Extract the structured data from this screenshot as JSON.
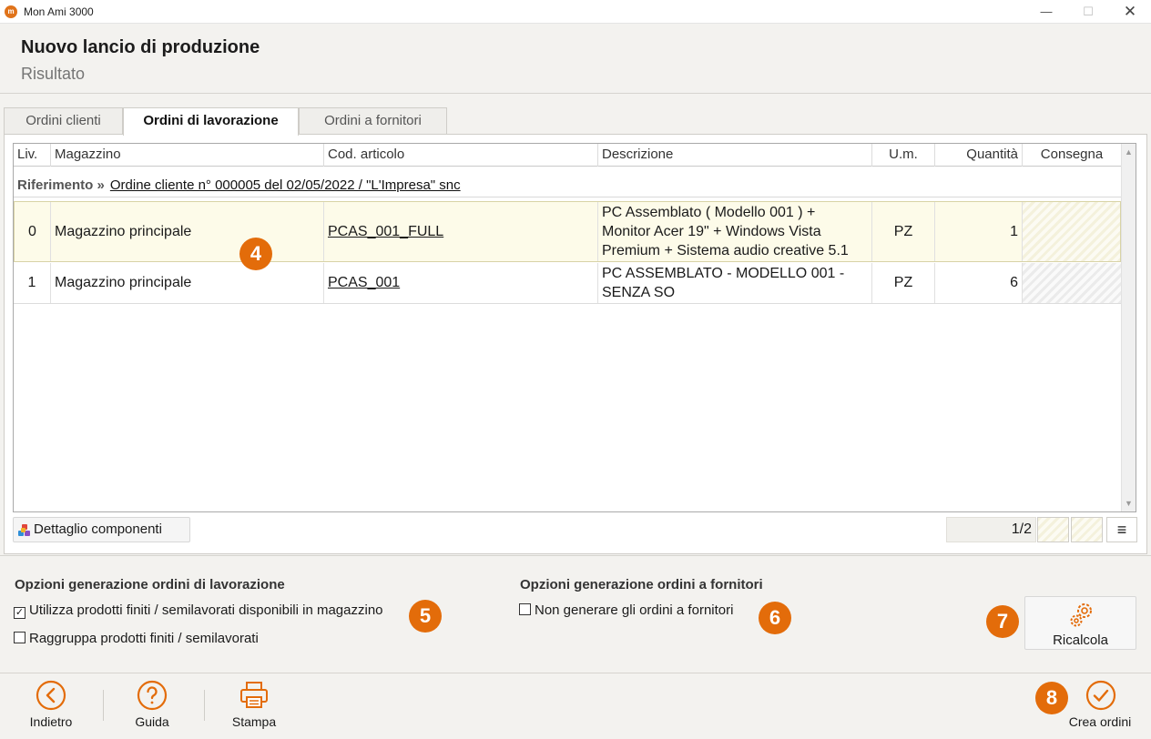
{
  "window": {
    "title": "Mon Ami 3000",
    "app_logo": "m"
  },
  "header": {
    "title": "Nuovo lancio di produzione",
    "subtitle": "Risultato"
  },
  "tabs": [
    {
      "label": "Ordini clienti",
      "active": false
    },
    {
      "label": "Ordini di lavorazione",
      "active": true
    },
    {
      "label": "Ordini a fornitori",
      "active": false
    }
  ],
  "grid": {
    "columns": [
      "Liv.",
      "Magazzino",
      "Cod. articolo",
      "Descrizione",
      "U.m.",
      "Quantità",
      "Consegna"
    ],
    "reference": {
      "label": "Riferimento »",
      "link": "Ordine cliente n° 000005 del 02/05/2022 / \"L'Impresa\" snc"
    },
    "rows": [
      {
        "liv": "0",
        "magazzino": "Magazzino principale",
        "codice": "PCAS_001_FULL",
        "descrizione": [
          "PC Assemblato ( Modello 001 ) +",
          "Monitor Acer 19\" + Windows Vista",
          "Premium + Sistema audio creative 5.1"
        ],
        "um": "PZ",
        "quantita": "1",
        "consegna": ""
      },
      {
        "liv": "1",
        "magazzino": "Magazzino principale",
        "codice": "PCAS_001",
        "descrizione": [
          "PC ASSEMBLATO - MODELLO 001 -",
          "SENZA SO"
        ],
        "um": "PZ",
        "quantita": "6",
        "consegna": ""
      }
    ]
  },
  "toolbar": {
    "detail_label": "Dettaglio componenti",
    "pager": "1/2",
    "menu_icon": "≡"
  },
  "options": {
    "lavorazione_title": "Opzioni generazione ordini di lavorazione",
    "utilizza_label": "Utilizza prodotti finiti / semilavorati disponibili in magazzino",
    "utilizza_checked": true,
    "raggruppa_label": "Raggruppa prodotti finiti / semilavorati",
    "raggruppa_checked": false,
    "fornitori_title": "Opzioni generazione ordini a fornitori",
    "non_generare_label": "Non generare gli ordini a fornitori",
    "non_generare_checked": false,
    "ricalcola_label": "Ricalcola"
  },
  "footer": {
    "back_label": "Indietro",
    "help_label": "Guida",
    "print_label": "Stampa",
    "create_label": "Crea ordini"
  },
  "badges": [
    "4",
    "5",
    "6",
    "7",
    "8"
  ],
  "colors": {
    "accent": "#e36c0a",
    "selected_row": "#fdfbe9"
  }
}
